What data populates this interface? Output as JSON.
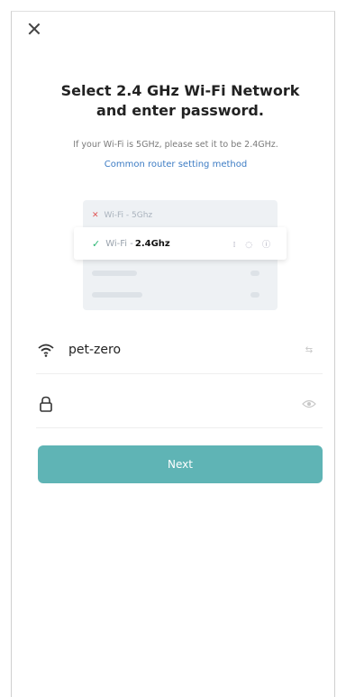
{
  "header": {
    "close_label": ""
  },
  "title_line1": "Select 2.4 GHz Wi-Fi Network",
  "title_line2": "and enter password.",
  "subtitle": "If your Wi-Fi is 5GHz, please set it to be 2.4GHz.",
  "link": "Common router setting method",
  "illustration": {
    "row_5g_label": "Wi-Fi - 5Ghz",
    "row_24_prefix": "Wi-Fi - ",
    "row_24_freq": "2.4Ghz"
  },
  "wifi_field": {
    "value": "pet-zero"
  },
  "password_field": {
    "value": ""
  },
  "next_button": {
    "label": "Next"
  },
  "colors": {
    "accent": "#5fb4b5",
    "link": "#3d7cc4",
    "error": "#e05555",
    "ok": "#2bb673"
  },
  "icons": [
    "close-icon",
    "x-mark-icon",
    "check-icon",
    "wifi-icon",
    "lock-icon",
    "router-icon",
    "eye-icon"
  ]
}
